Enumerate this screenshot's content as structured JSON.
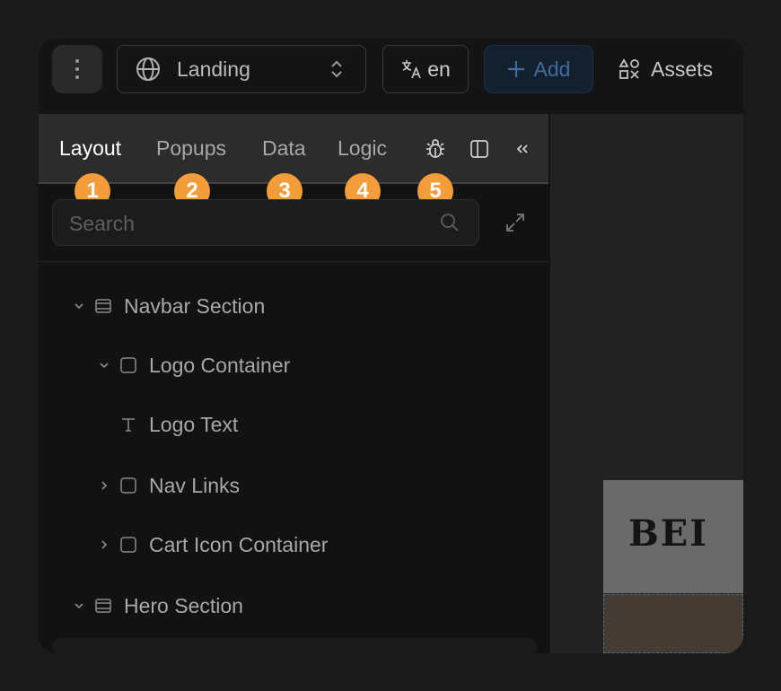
{
  "topbar": {
    "page_select": "Landing",
    "language": "en",
    "add_label": "Add",
    "assets_label": "Assets"
  },
  "tabs": [
    {
      "label": "Layout",
      "active": true
    },
    {
      "label": "Popups",
      "active": false
    },
    {
      "label": "Data",
      "active": false
    },
    {
      "label": "Logic",
      "active": false
    }
  ],
  "badges": [
    "1",
    "2",
    "3",
    "4",
    "5"
  ],
  "search": {
    "placeholder": "Search",
    "value": ""
  },
  "tree": [
    {
      "label": "Navbar Section",
      "icon": "section-icon",
      "expanded": true
    },
    {
      "label": "Logo Container",
      "icon": "container-icon",
      "expanded": true
    },
    {
      "label": "Logo Text",
      "icon": "text-icon"
    },
    {
      "label": "Nav Links",
      "icon": "container-icon",
      "expanded": false
    },
    {
      "label": "Cart Icon Container",
      "icon": "container-icon",
      "expanded": false
    },
    {
      "label": "Hero Section",
      "icon": "section-icon",
      "expanded": true
    }
  ],
  "preview": {
    "brand_text": "BEI"
  },
  "colors": {
    "badge": "#f39c3c",
    "add_button_text": "#3f6e9e",
    "active_tab": "#ffffff",
    "panel_bg": "#121212",
    "tabs_bg": "#2c2c2c"
  }
}
